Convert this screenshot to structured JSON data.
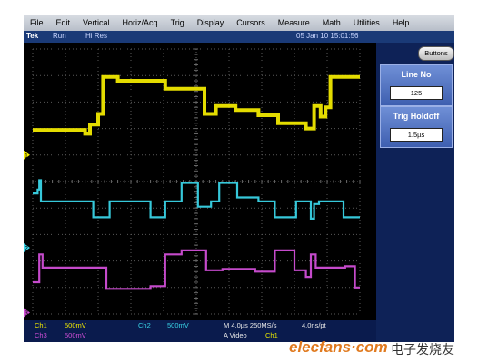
{
  "menu": [
    "File",
    "Edit",
    "Vertical",
    "Horiz/Acq",
    "Trig",
    "Display",
    "Cursors",
    "Measure",
    "Math",
    "Utilities",
    "Help"
  ],
  "status": {
    "brand": "Tek",
    "run_state": "Run",
    "acq_mode": "Hi Res",
    "timestamp": "05 Jan 10 15:01:56"
  },
  "panel": {
    "buttons_label": "Buttons",
    "line_no": {
      "title": "Line No",
      "value": "125"
    },
    "trig_holdoff": {
      "title": "Trig Holdoff",
      "value": "1.5µs"
    }
  },
  "markers": {
    "ch1": "1",
    "ch2": "2",
    "ch3": "3"
  },
  "readout": {
    "ch1_label": "Ch1",
    "ch1_scale": "500mV",
    "ch2_label": "Ch2",
    "ch2_scale": "500mV",
    "ch3_label": "Ch3",
    "ch3_scale": "500mV",
    "timebase": "M 4.0µs 250MS/s",
    "resolution": "4.0ns/pt",
    "trigger": "A  Video",
    "trigger_source": "Ch1"
  },
  "watermark": {
    "logo": "elecfans·com",
    "cn": "电子发烧友"
  },
  "colors": {
    "ch1": "#f0e800",
    "ch2": "#39d3e6",
    "ch3": "#d04ed6",
    "panel": "#0e2257"
  },
  "waveforms": {
    "ch1": [
      [
        0,
        3.05
      ],
      [
        1.6,
        3.05
      ],
      [
        1.6,
        3.2
      ],
      [
        1.75,
        3.2
      ],
      [
        1.75,
        2.85
      ],
      [
        2.0,
        2.85
      ],
      [
        2.0,
        2.45
      ],
      [
        2.15,
        2.45
      ],
      [
        2.15,
        1.05
      ],
      [
        2.6,
        1.05
      ],
      [
        2.6,
        1.2
      ],
      [
        4.05,
        1.2
      ],
      [
        4.05,
        1.5
      ],
      [
        5.25,
        1.5
      ],
      [
        5.25,
        2.45
      ],
      [
        5.6,
        2.45
      ],
      [
        5.6,
        2.15
      ],
      [
        6.2,
        2.15
      ],
      [
        6.2,
        2.3
      ],
      [
        6.9,
        2.3
      ],
      [
        6.9,
        2.5
      ],
      [
        7.5,
        2.5
      ],
      [
        7.5,
        2.8
      ],
      [
        8.35,
        2.8
      ],
      [
        8.35,
        3.0
      ],
      [
        8.6,
        3.0
      ],
      [
        8.6,
        2.15
      ],
      [
        8.8,
        2.15
      ],
      [
        8.8,
        2.55
      ],
      [
        8.95,
        2.55
      ],
      [
        8.95,
        2.2
      ],
      [
        9.1,
        2.2
      ],
      [
        9.1,
        1.05
      ],
      [
        10,
        1.05
      ]
    ],
    "ch2": [
      [
        0,
        5.45
      ],
      [
        0.15,
        5.45
      ],
      [
        0.15,
        5.3
      ],
      [
        0.2,
        5.3
      ],
      [
        0.2,
        4.95
      ],
      [
        0.25,
        4.95
      ],
      [
        0.25,
        5.75
      ],
      [
        1.85,
        5.75
      ],
      [
        1.85,
        6.35
      ],
      [
        2.35,
        6.35
      ],
      [
        2.35,
        5.75
      ],
      [
        3.6,
        5.75
      ],
      [
        3.6,
        6.35
      ],
      [
        4.05,
        6.35
      ],
      [
        4.05,
        5.75
      ],
      [
        4.55,
        5.75
      ],
      [
        4.55,
        5.05
      ],
      [
        5.05,
        5.05
      ],
      [
        5.05,
        5.95
      ],
      [
        5.45,
        5.95
      ],
      [
        5.45,
        5.75
      ],
      [
        5.7,
        5.75
      ],
      [
        5.7,
        5.05
      ],
      [
        6.25,
        5.05
      ],
      [
        6.25,
        5.6
      ],
      [
        6.9,
        5.6
      ],
      [
        6.9,
        5.75
      ],
      [
        7.4,
        5.75
      ],
      [
        7.4,
        6.35
      ],
      [
        8.05,
        6.35
      ],
      [
        8.05,
        5.75
      ],
      [
        8.5,
        5.75
      ],
      [
        8.5,
        6.4
      ],
      [
        8.6,
        6.4
      ],
      [
        8.6,
        5.85
      ],
      [
        8.75,
        5.85
      ],
      [
        8.75,
        5.75
      ],
      [
        9.5,
        5.75
      ],
      [
        9.5,
        6.35
      ],
      [
        10,
        6.35
      ]
    ],
    "ch3": [
      [
        0,
        8.8
      ],
      [
        0.2,
        8.8
      ],
      [
        0.2,
        7.75
      ],
      [
        0.3,
        7.75
      ],
      [
        0.3,
        8.25
      ],
      [
        2.25,
        8.25
      ],
      [
        2.25,
        9.05
      ],
      [
        3.6,
        9.05
      ],
      [
        3.6,
        8.95
      ],
      [
        4.05,
        8.95
      ],
      [
        4.05,
        7.75
      ],
      [
        4.55,
        7.75
      ],
      [
        4.55,
        7.6
      ],
      [
        5.3,
        7.6
      ],
      [
        5.3,
        8.35
      ],
      [
        5.8,
        8.35
      ],
      [
        5.8,
        8.3
      ],
      [
        6.8,
        8.3
      ],
      [
        6.8,
        8.4
      ],
      [
        7.4,
        8.4
      ],
      [
        7.4,
        7.6
      ],
      [
        8.0,
        7.6
      ],
      [
        8.0,
        8.35
      ],
      [
        8.35,
        8.35
      ],
      [
        8.35,
        8.6
      ],
      [
        8.5,
        8.6
      ],
      [
        8.5,
        7.75
      ],
      [
        8.65,
        7.75
      ],
      [
        8.65,
        8.25
      ],
      [
        9.55,
        8.25
      ],
      [
        9.55,
        8.2
      ],
      [
        9.85,
        8.2
      ],
      [
        9.85,
        9.0
      ],
      [
        10,
        9.0
      ]
    ]
  }
}
